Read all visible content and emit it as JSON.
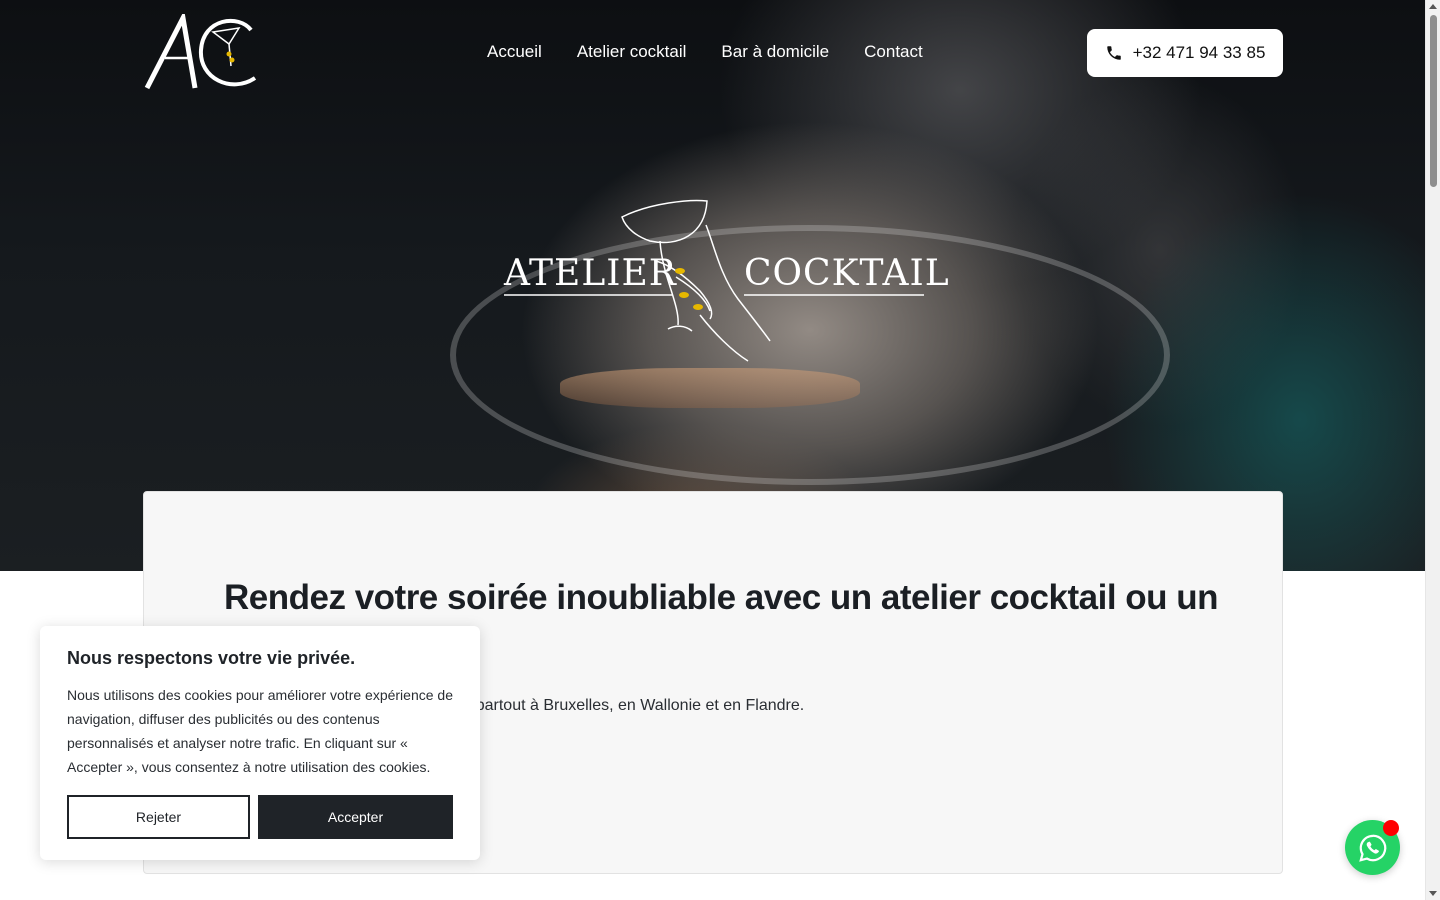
{
  "brand": {
    "logo_name": "AC monogram logo",
    "accent_color": "#e6b800"
  },
  "nav": {
    "items": [
      {
        "label": "Accueil"
      },
      {
        "label": "Atelier cocktail"
      },
      {
        "label": "Bar à domicile"
      },
      {
        "label": "Contact"
      }
    ]
  },
  "header": {
    "phone_label": "+32 471 94 33 85",
    "phone_icon": "phone-icon"
  },
  "hero": {
    "emblem_left": "ATELIER",
    "emblem_right": "COCKTAIL"
  },
  "card": {
    "heading": "Rendez votre soirée inoubliable avec un atelier cocktail ou un bar à cocktails",
    "text": "Nous nous déplaçons jusqu’à vous partout à Bruxelles, en Wallonie et en Flandre."
  },
  "cookie": {
    "title": "Nous respectons votre vie privée.",
    "text": "Nous utilisons des cookies pour améliorer votre expérience de navigation, diffuser des publicités ou des contenus personnalisés et analyser notre trafic. En cliquant sur « Accepter », vous consentez à notre utilisation des cookies.",
    "reject_label": "Rejeter",
    "accept_label": "Accepter"
  },
  "whatsapp": {
    "icon": "whatsapp-icon",
    "color": "#25d366",
    "badge_color": "#ff0000"
  }
}
